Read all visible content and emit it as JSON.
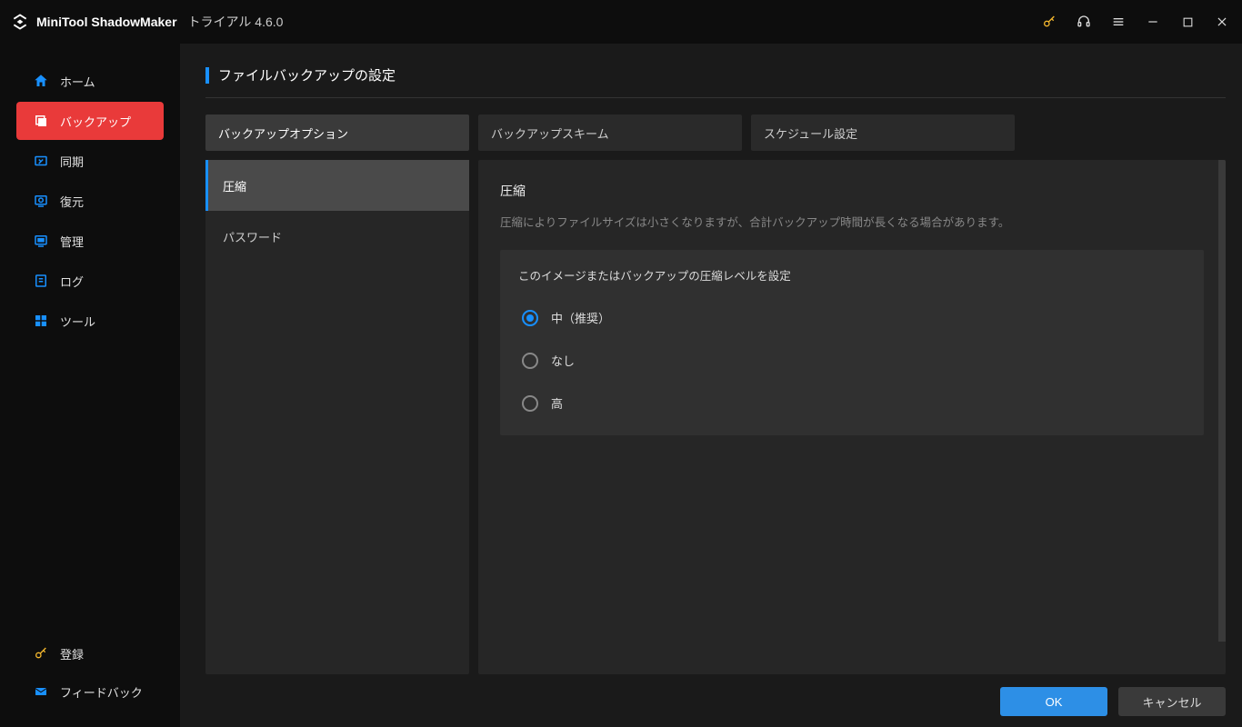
{
  "titlebar": {
    "app_name": "MiniTool ShadowMaker",
    "edition": "トライアル 4.6.0"
  },
  "sidebar": {
    "items": [
      {
        "label": "ホーム"
      },
      {
        "label": "バックアップ"
      },
      {
        "label": "同期"
      },
      {
        "label": "復元"
      },
      {
        "label": "管理"
      },
      {
        "label": "ログ"
      },
      {
        "label": "ツール"
      }
    ],
    "bottom": [
      {
        "label": "登録"
      },
      {
        "label": "フィードバック"
      }
    ]
  },
  "page": {
    "title": "ファイルバックアップの設定",
    "tabs": [
      {
        "label": "バックアップオプション"
      },
      {
        "label": "バックアップスキーム"
      },
      {
        "label": "スケジュール設定"
      }
    ],
    "sub_items": [
      {
        "label": "圧縮"
      },
      {
        "label": "パスワード"
      }
    ],
    "detail": {
      "heading": "圧縮",
      "desc": "圧縮によりファイルサイズは小さくなりますが、合計バックアップ時間が長くなる場合があります。",
      "box_title": "このイメージまたはバックアップの圧縮レベルを設定",
      "options": [
        {
          "label": "中（推奨）",
          "checked": true
        },
        {
          "label": "なし",
          "checked": false
        },
        {
          "label": "高",
          "checked": false
        }
      ]
    },
    "footer": {
      "ok": "OK",
      "cancel": "キャンセル"
    }
  }
}
